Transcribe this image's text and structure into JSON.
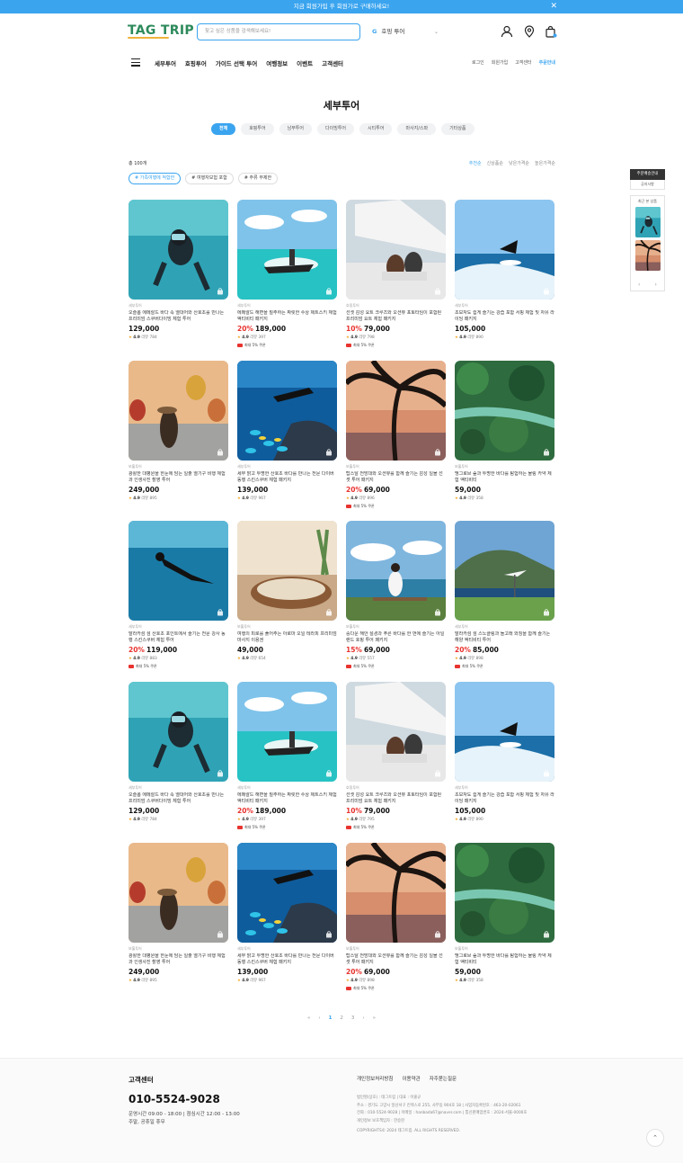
{
  "topbar": {
    "text": "지금 회원가입 후 회원가로 구매하세요!",
    "close": "✕"
  },
  "header": {
    "logo_tag": "TAG",
    "logo_trip": "TRIP",
    "search_placeholder": "찾고 싶은 상품을 검색해보세요!",
    "tour_select_icon": "G",
    "tour_select": "호핑 투어"
  },
  "nav": {
    "main": [
      "세부투어",
      "호핑투어",
      "가이드 선택 투어",
      "여행정보",
      "이벤트",
      "고객센터"
    ],
    "util": [
      "로그인",
      "회원가입",
      "고객센터",
      "주문안내"
    ]
  },
  "page_title": "세부투어",
  "categories": [
    "전체",
    "호핑투어",
    "남부투어",
    "다이빙투어",
    "시티투어",
    "마사지/스파",
    "기타상품"
  ],
  "count": "총 100개",
  "sort": [
    "추천순",
    "신상품순",
    "낮은가격순",
    "높은가격순"
  ],
  "tags": [
    "# 가족여행에 적합한",
    "# 여행자보험 포함",
    "# 주류 무제한"
  ],
  "products": [
    {
      "cat": "세부투어",
      "name": "오슬롭 에메랄드 바다 속 열대어와 산호초를 만나는 프리미엄 스쿠버다이빙 체험 투어",
      "disc": "",
      "price": "129,000",
      "rating": "4.9",
      "reviews": "리뷰 784",
      "coupon": "",
      "img": "diver"
    },
    {
      "cat": "세부투어",
      "name": "에메랄드 해변을 질주하는 짜릿한 수상 제트스키 체험 액티비티 패키지",
      "disc": "20%",
      "price": "189,000",
      "rating": "4.9",
      "reviews": "리뷰 397",
      "coupon": "최대 5% 쿠폰",
      "img": "jetski"
    },
    {
      "cat": "호핑투어",
      "name": "선셋 감성 요트 크루즈와 오션뷰 포토타임이 포함된 프리미엄 요트 체험 패키지",
      "disc": "10%",
      "price": "79,000",
      "rating": "4.9",
      "reviews": "리뷰 798",
      "coupon": "최대 5% 쿠폰",
      "img": "yacht"
    },
    {
      "cat": "세부투어",
      "name": "초보자도 쉽게 즐기는 강습 포함 서핑 체험 및 자유 라이딩 패키지",
      "disc": "",
      "price": "105,000",
      "rating": "4.9",
      "reviews": "리뷰 890",
      "coupon": "",
      "img": "surf"
    },
    {
      "cat": "보홀투어",
      "name": "광활한 대평원을 한눈에 담는 일출 열기구 비행 체험과 인생사진 촬영 투어",
      "disc": "",
      "price": "249,000",
      "rating": "4.9",
      "reviews": "리뷰 895",
      "coupon": "",
      "img": "balloon"
    },
    {
      "cat": "세부투어",
      "name": "세부 맑고 투명한 산호초 바다를 만나는 전문 다이버 동행 스킨스쿠버 체험 패키지",
      "disc": "",
      "price": "139,000",
      "rating": "4.9",
      "reviews": "리뷰 967",
      "coupon": "",
      "img": "reef"
    },
    {
      "cat": "보홀투어",
      "name": "탑스탈 전망대와 오션뷰를 함께 즐기는 감성 일몰 선셋 투어 패키지",
      "disc": "20%",
      "price": "69,000",
      "rating": "4.9",
      "reviews": "리뷰 896",
      "coupon": "최대 5% 쿠폰",
      "img": "palm"
    },
    {
      "cat": "보홀투어",
      "name": "맹그로브 숲과 투명한 바다를 탐험하는 물링 카약 체험 액티비티",
      "disc": "",
      "price": "59,000",
      "rating": "4.9",
      "reviews": "리뷰 358",
      "coupon": "",
      "img": "forest"
    },
    {
      "cat": "세부투어",
      "name": "말라카섬 섬 산호초 포인트에서 즐기는 전문 강사 동행 스킨스쿠버 체험 투어",
      "disc": "20%",
      "price": "119,000",
      "rating": "4.9",
      "reviews": "리뷰 883",
      "coupon": "최대 5% 쿠폰",
      "img": "blue"
    },
    {
      "cat": "보홀투어",
      "name": "여행의 피로를 풀어주는 아로마 오일 테라피 프리미엄 마사지 이용권",
      "disc": "",
      "price": "49,000",
      "rating": "4.9",
      "reviews": "리뷰 654",
      "coupon": "",
      "img": "spa"
    },
    {
      "cat": "보홀투어",
      "name": "중다운 해안 절경과 푸른 바다를 한 번에 즐기는 아일랜드 호핑 투어 패키지",
      "disc": "15%",
      "price": "69,000",
      "rating": "4.9",
      "reviews": "리뷰 557",
      "coupon": "최대 5% 쿠폰",
      "img": "coast"
    },
    {
      "cat": "세부투어",
      "name": "말라카섬 섬 스노클링과 돌고래 와칭을 함께 즐기는 해양 액티비티 투어",
      "disc": "20%",
      "price": "85,000",
      "rating": "4.9",
      "reviews": "리뷰 898",
      "coupon": "최대 5% 쿠폰",
      "img": "cliff"
    },
    {
      "cat": "세부투어",
      "name": "오슬롭 에메랄드 바다 속 열대어와 산호초를 만나는 프리미엄 스쿠버다이빙 체험 투어",
      "disc": "",
      "price": "129,000",
      "rating": "4.9",
      "reviews": "리뷰 784",
      "coupon": "",
      "img": "diver"
    },
    {
      "cat": "세부투어",
      "name": "에메랄드 해변을 질주하는 짜릿한 수상 제트스키 체험 액티비티 패키지",
      "disc": "20%",
      "price": "189,000",
      "rating": "4.9",
      "reviews": "리뷰 397",
      "coupon": "최대 5% 쿠폰",
      "img": "jetski"
    },
    {
      "cat": "호핑투어",
      "name": "선셋 감성 요트 크루즈와 오션뷰 포토타임이 포함된 프리미엄 요트 체험 패키지",
      "disc": "10%",
      "price": "79,000",
      "rating": "4.9",
      "reviews": "리뷰 795",
      "coupon": "최대 5% 쿠폰",
      "img": "yacht"
    },
    {
      "cat": "세부투어",
      "name": "초보자도 쉽게 즐기는 강습 포함 서핑 체험 및 자유 라이딩 패키지",
      "disc": "",
      "price": "105,000",
      "rating": "4.9",
      "reviews": "리뷰 890",
      "coupon": "",
      "img": "surf"
    },
    {
      "cat": "보홀투어",
      "name": "광활한 대평원을 한눈에 담는 일출 열기구 비행 체험과 인생사진 촬영 투어",
      "disc": "",
      "price": "249,000",
      "rating": "4.9",
      "reviews": "리뷰 895",
      "coupon": "",
      "img": "balloon"
    },
    {
      "cat": "세부투어",
      "name": "세부 맑고 투명한 산호초 바다를 만나는 전문 다이버 동행 스킨스쿠버 체험 패키지",
      "disc": "",
      "price": "139,000",
      "rating": "4.9",
      "reviews": "리뷰 967",
      "coupon": "",
      "img": "reef"
    },
    {
      "cat": "보홀투어",
      "name": "탑스탈 전망대와 오션뷰를 함께 즐기는 감성 일몰 선셋 투어 패키지",
      "disc": "20%",
      "price": "69,000",
      "rating": "4.9",
      "reviews": "리뷰 898",
      "coupon": "최대 5% 쿠폰",
      "img": "palm"
    },
    {
      "cat": "보홀투어",
      "name": "맹그로브 숲과 투명한 바다를 탐험하는 물링 카약 체험 액티비티",
      "disc": "",
      "price": "59,000",
      "rating": "4.9",
      "reviews": "리뷰 358",
      "coupon": "",
      "img": "forest"
    }
  ],
  "sidebar": {
    "head": "주문배송안내",
    "sub": "공지사항",
    "recent": "최근 본 상품",
    "prev": "‹",
    "next": "›"
  },
  "pager": [
    "«",
    "‹",
    "1",
    "2",
    "3",
    "›",
    "»"
  ],
  "footer": {
    "title": "고객센터",
    "phone": "010-5524-9028",
    "hours1": "운영시간  09:00 - 18:00  |  점심시간 12:00 - 13:00",
    "hours2": "주말, 공휴일 휴무",
    "links": [
      "개인정보처리방침",
      "이용약관",
      "자주묻는질문"
    ],
    "info": [
      "법인명(상호) : 태그트립  |  대표 : 이홍규",
      "주소 : 경기도 고양시 일산서구 킨텍스로 255, 사무동 904호 18  |  사업자등록번호 : 463-20-02061",
      "전화 : 010-5524-9028  |  이메일 : hanbada67@naver.com  |  통신판매업번호 : 2024-서울-0000호",
      "개인정보 보호책임자 : 한승현",
      "COPYRIGHTS© 2024 태그트립. ALL RIGHTS RESERVED."
    ],
    "top": "⌃"
  }
}
